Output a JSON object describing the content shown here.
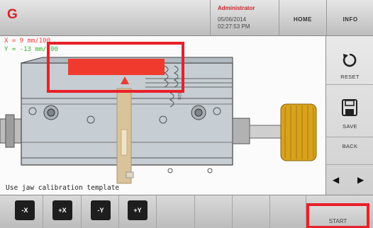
{
  "topbar": {
    "logo": "G",
    "user": "Administrator",
    "date": "05/06/2014",
    "time": "02:27:53 PM",
    "home_label": "HOME",
    "info_label": "INFO"
  },
  "canvas": {
    "coord_x": "X = 9 mm/100",
    "coord_y": "Y = -13 mm/100",
    "hint": "Use jaw calibration template",
    "jaw_mark": "B2B"
  },
  "sidebar": {
    "reset_label": "RESET",
    "save_label": "SAVE",
    "back_label": "BACK"
  },
  "bottombar": {
    "jog_minus_x": "-X",
    "jog_plus_x": "+X",
    "jog_minus_y": "-Y",
    "jog_plus_y": "+Y",
    "start_label": "START"
  },
  "colors": {
    "accent_red": "#e8202a",
    "x_coord": "#ff3b3b",
    "y_coord": "#2db52d",
    "template_red": "#f03a2e",
    "knob_gold": "#d8a21c"
  },
  "icons": [
    "reset-icon",
    "save-icon",
    "arrow-left-icon",
    "arrow-right-icon"
  ]
}
